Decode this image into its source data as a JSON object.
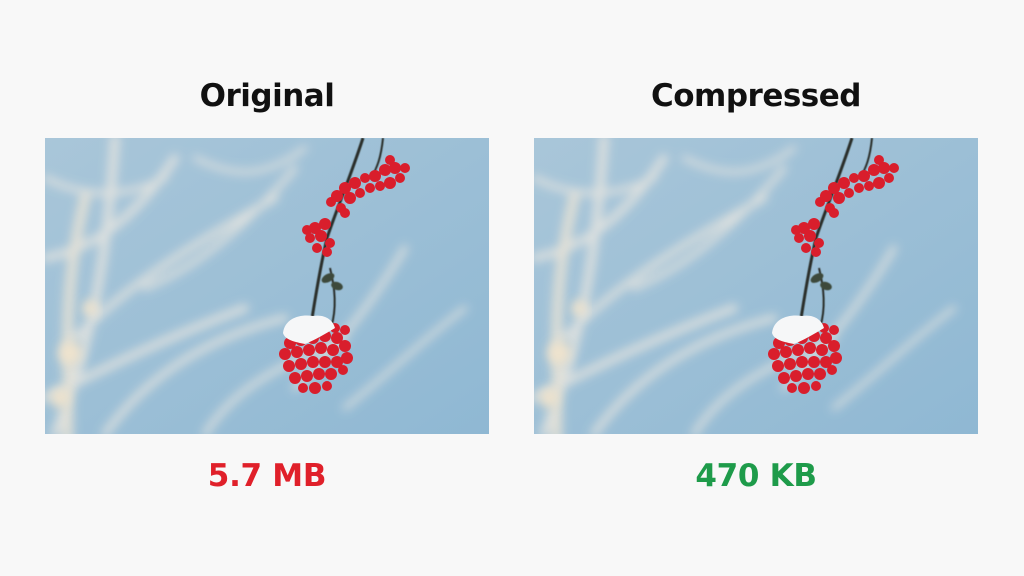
{
  "comparison": [
    {
      "title": "Original",
      "image": {
        "label": "Rowan berries with snow against blue sky",
        "kind": "photo"
      },
      "size": "5.7 MB",
      "size_color": "#e0202a"
    },
    {
      "title": "Compressed",
      "image": {
        "label": "Rowan berries with snow against blue sky",
        "kind": "photo"
      },
      "size": "470 KB",
      "size_color": "#1e9b4a"
    }
  ],
  "colors": {
    "background": "#f8f8f8",
    "title": "#111111",
    "sky": "#9fc0d6",
    "berries": "#d91e2c"
  }
}
